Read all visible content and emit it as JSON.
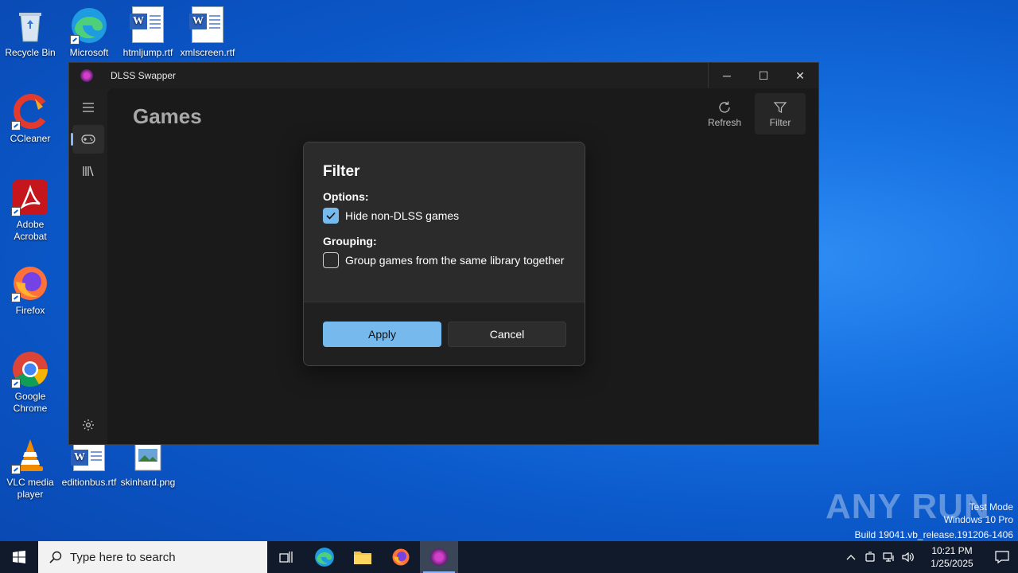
{
  "desktop": {
    "icons": [
      {
        "label": "Recycle Bin"
      },
      {
        "label": "Microsoft Edge"
      },
      {
        "label": "htmljump.rtf"
      },
      {
        "label": "xmlscreen.rtf"
      },
      {
        "label": "CCleaner"
      },
      {
        "label": "Adobe Acrobat"
      },
      {
        "label": "Firefox"
      },
      {
        "label": "Google Chrome"
      },
      {
        "label": "VLC media player"
      },
      {
        "label": "editionbus.rtf"
      },
      {
        "label": "skinhard.png"
      }
    ]
  },
  "window": {
    "title": "DLSS Swapper",
    "controls": {
      "minimize": "─",
      "maximize": "☐",
      "close": "✕"
    }
  },
  "nav": {
    "items": [
      {
        "icon": "hamburger-menu-icon"
      },
      {
        "icon": "gamepad-icon",
        "selected": true
      },
      {
        "icon": "library-icon"
      },
      {
        "icon": "settings-gear-icon"
      }
    ]
  },
  "page": {
    "title": "Games",
    "commands": {
      "refresh": "Refresh",
      "filter": "Filter"
    }
  },
  "dialog": {
    "title": "Filter",
    "options_label": "Options:",
    "hide_non_dlss": {
      "label": "Hide non-DLSS games",
      "checked": true
    },
    "grouping_label": "Grouping:",
    "group_library": {
      "label": "Group games from the same library together",
      "checked": false
    },
    "apply": "Apply",
    "cancel": "Cancel"
  },
  "watermark": {
    "brand": "ANY RUN",
    "line1": "Test Mode",
    "line2": "Windows 10 Pro",
    "line3": "Build 19041.vb_release.191206-1406"
  },
  "taskbar": {
    "search_placeholder": "Type here to search",
    "time": "10:21 PM",
    "date": "1/25/2025"
  },
  "colors": {
    "accent": "#76b9ed",
    "window_bg": "#202020",
    "dialog_bg": "#2b2b2b"
  }
}
